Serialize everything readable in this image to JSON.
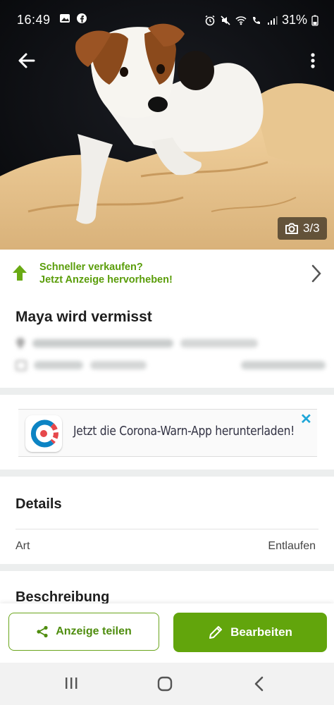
{
  "status_bar": {
    "time": "16:49",
    "battery": "31%"
  },
  "hero": {
    "photo_counter": "3/3"
  },
  "promo": {
    "line1": "Schneller verkaufen?",
    "line2": "Jetzt Anzeige hervorheben!"
  },
  "ad": {
    "title": "Maya wird vermisst"
  },
  "banner": {
    "text": "Jetzt die Corona-Warn-App herunterladen!",
    "close": "✕"
  },
  "details": {
    "heading": "Details",
    "rows": [
      {
        "label": "Art",
        "value": "Entlaufen"
      }
    ]
  },
  "description": {
    "heading": "Beschreibung"
  },
  "actions": {
    "share_label": "Anzeige teilen",
    "edit_label": "Bearbeiten"
  },
  "colors": {
    "accent_green": "#62a50c",
    "promo_green": "#5a9d0a",
    "close_blue": "#1fa6d8"
  }
}
